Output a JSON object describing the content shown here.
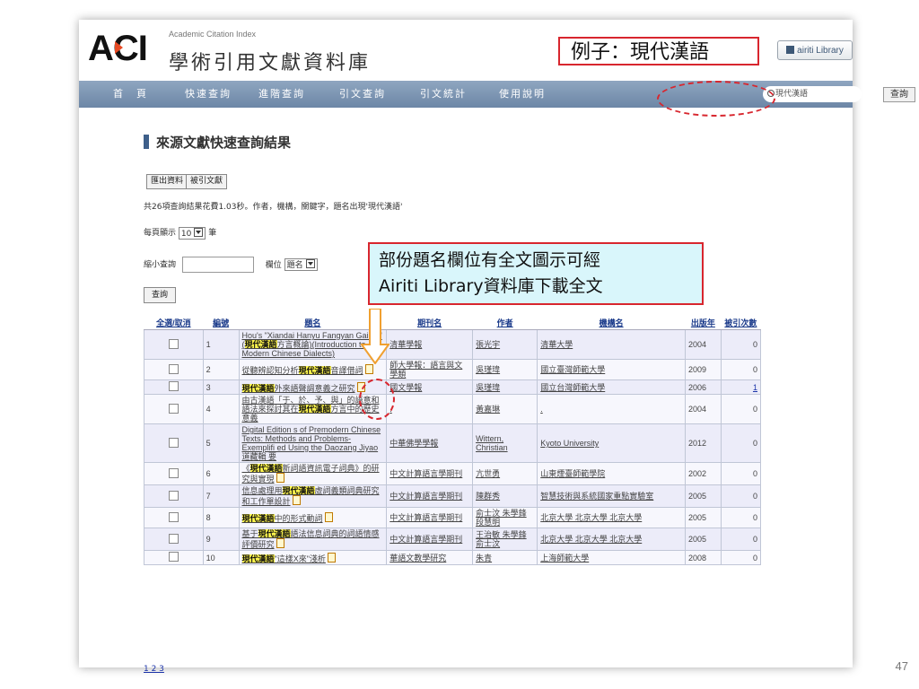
{
  "header": {
    "logo_text": "AC",
    "logo_last": "I",
    "english_sub": "Academic Citation Index",
    "chinese_title": "學術引用文獻資料庫",
    "example_label": "例子：現代漢語",
    "airiti_button": "airiti Library"
  },
  "nav": {
    "items": [
      "首　頁",
      "快速查詢",
      "進階查詢",
      "引文查詢",
      "引文統計",
      "使用說明"
    ],
    "search_value": "現代漢語",
    "search_button": "查詢"
  },
  "content": {
    "section_title": "來源文獻快速查詢結果",
    "export_button": "匯出資料",
    "cited_button": "被引文獻",
    "result_info": "共26項查詢結果花費1.03秒。作者，機構，關鍵字，題名出現'現代漢語'",
    "per_page_label": "每頁顯示",
    "per_page_value": "10",
    "per_page_unit": "筆",
    "narrow_label": "縮小查詢",
    "field_label": "欄位",
    "field_value": "題名",
    "query_button": "查詢",
    "callout_line1": "部份題名欄位有全文圖示可經",
    "callout_line2": "Airiti Library資料庫下載全文"
  },
  "table": {
    "headers": [
      "全選/取消",
      "編號",
      "題名",
      "期刊名",
      "作者",
      "機構名",
      "出版年",
      "被引次數"
    ],
    "rows": [
      {
        "num": "1",
        "title_a": "Hou's \"Xiandai Hanyu Fangyan Gailun\"(",
        "hl": "現代漢語",
        "title_b": "方言概論)(Introduction to Modern Chinese Dialects)",
        "pdf": false,
        "journal": "清華學報",
        "author": "張光宇",
        "inst": "清華大學",
        "year": "2004",
        "cites": "0"
      },
      {
        "num": "2",
        "title_a": "從聽辨認知分析",
        "hl": "現代漢語",
        "title_b": "音譯借詞",
        "pdf": true,
        "journal": "師大學報：語言與文學類",
        "author": "吳瑾瑋",
        "inst": "國立臺灣師範大學",
        "year": "2009",
        "cites": "0"
      },
      {
        "num": "3",
        "title_a": "",
        "hl": "現代漢語",
        "title_b": "外來語聲調意義之研究",
        "pdf": true,
        "journal": "國文學報",
        "author": "吳瑾瑋",
        "inst": "國立台灣師範大學",
        "year": "2006",
        "cites": "1"
      },
      {
        "num": "4",
        "title_a": "由古漢語「于、於、予、與」的語意和語法來探討其在",
        "hl": "現代漢語",
        "title_b": "方言中的歷史意義",
        "pdf": false,
        "journal": ".",
        "author": "黃嘉琳",
        "inst": ".",
        "year": "2004",
        "cites": "0"
      },
      {
        "num": "5",
        "title_a": "Digital Edition s of Premodern Chinese Texts: Methods and Problems-Exemplifi ed Using the Daozang Jiyao 道藏輯 要",
        "hl": "",
        "title_b": "",
        "pdf": false,
        "journal": "中華佛學學報",
        "author": "Wittern, Christian",
        "inst": "Kyoto University",
        "year": "2012",
        "cites": "0"
      },
      {
        "num": "6",
        "title_a": "《",
        "hl": "現代漢語",
        "title_b": "新詞語資訊電子詞典》的研究與實現",
        "pdf": true,
        "journal": "中文計算語言學期刊",
        "author": "亢世勇",
        "inst": "山東煙臺師範學院",
        "year": "2002",
        "cites": "0"
      },
      {
        "num": "7",
        "title_a": "信息處理用",
        "hl": "現代漢語",
        "title_b": "虛詞義類詞典研究和工作單設計",
        "pdf": true,
        "journal": "中文計算語言學期刊",
        "author": "陳群秀",
        "inst": "智慧技術與系統國家重點實驗室",
        "year": "2005",
        "cites": "0"
      },
      {
        "num": "8",
        "title_a": "",
        "hl": "現代漢語",
        "title_b": "中的形式動詞",
        "pdf": true,
        "journal": "中文計算語言學期刊",
        "author": "俞士汶 朱學鋒 段慧明",
        "inst": "北京大學 北京大學 北京大學",
        "year": "2005",
        "cites": "0"
      },
      {
        "num": "9",
        "title_a": "基于",
        "hl": "現代漢語",
        "title_b": "語法信息詞典的詞語情感評價研究",
        "pdf": true,
        "journal": "中文計算語言學期刊",
        "author": "王治敏 朱學鋒 俞士汶",
        "inst": "北京大學 北京大學 北京大學",
        "year": "2005",
        "cites": "0"
      },
      {
        "num": "10",
        "title_a": "",
        "hl": "現代漢語",
        "title_b": "\"這樣X來\"淺析",
        "pdf": true,
        "journal": "華語文教學研究",
        "author": "朱青",
        "inst": "上海師範大學",
        "year": "2008",
        "cites": "0"
      }
    ],
    "pager": "1 2 3"
  },
  "slide": {
    "page_number": "47"
  },
  "colors": {
    "nav_bg": "#7b93b0",
    "highlight": "#fff64d",
    "callout_bg": "#d9f6fb",
    "annotation_red": "#d8262e",
    "link_blue": "#1b33a8"
  }
}
